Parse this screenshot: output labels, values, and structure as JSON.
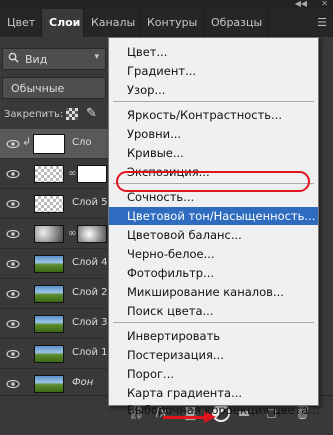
{
  "tabs": [
    "Цвет",
    "Слои",
    "Каналы",
    "Контуры",
    "Образцы"
  ],
  "filter_kind": "Вид",
  "blend_mode": "Обычные",
  "lock_label": "Закрепить:",
  "layers": [
    {
      "name": "Сло",
      "thumb": "white",
      "clip": true,
      "selected": true,
      "mask": false
    },
    {
      "name": "",
      "thumb": "check",
      "mask": true,
      "mask_type": "white"
    },
    {
      "name": "Слой 5",
      "thumb": "check",
      "mask": false
    },
    {
      "name": "",
      "thumb": "cloud",
      "mask": true,
      "mask_type": "cloud"
    },
    {
      "name": "Слой 4",
      "thumb": "land",
      "mask": false
    },
    {
      "name": "Слой 2",
      "thumb": "land",
      "mask": false
    },
    {
      "name": "Слой 3",
      "thumb": "land",
      "mask": false
    },
    {
      "name": "Слой 1",
      "thumb": "land",
      "mask": false
    },
    {
      "name": "Фон",
      "thumb": "land",
      "mask": false,
      "italic": true
    }
  ],
  "menu": {
    "group1": [
      "Цвет...",
      "Градиент...",
      "Узор..."
    ],
    "group2": [
      "Яркость/Контрастность...",
      "Уровни...",
      "Кривые...",
      "Экспозиция..."
    ],
    "group3": [
      "Сочность...",
      "Цветовой тон/Насыщенность...",
      "Цветовой баланс...",
      "Черно-белое...",
      "Фотофильтр...",
      "Микширование каналов...",
      "Поиск цвета..."
    ],
    "group4": [
      "Инвертировать",
      "Постеризация...",
      "Порог...",
      "Карта градиента...",
      "Выборочная коррекция цвета..."
    ],
    "highlighted": "Цветовой тон/Насыщенность..."
  },
  "bottom_icons": [
    "link-icon",
    "fx-icon",
    "mask-icon",
    "adjustment-icon",
    "folder-icon",
    "new-layer-icon",
    "trash-icon"
  ],
  "colors": {
    "highlight": "#2f6bbf",
    "annotation": "#e0141c"
  }
}
